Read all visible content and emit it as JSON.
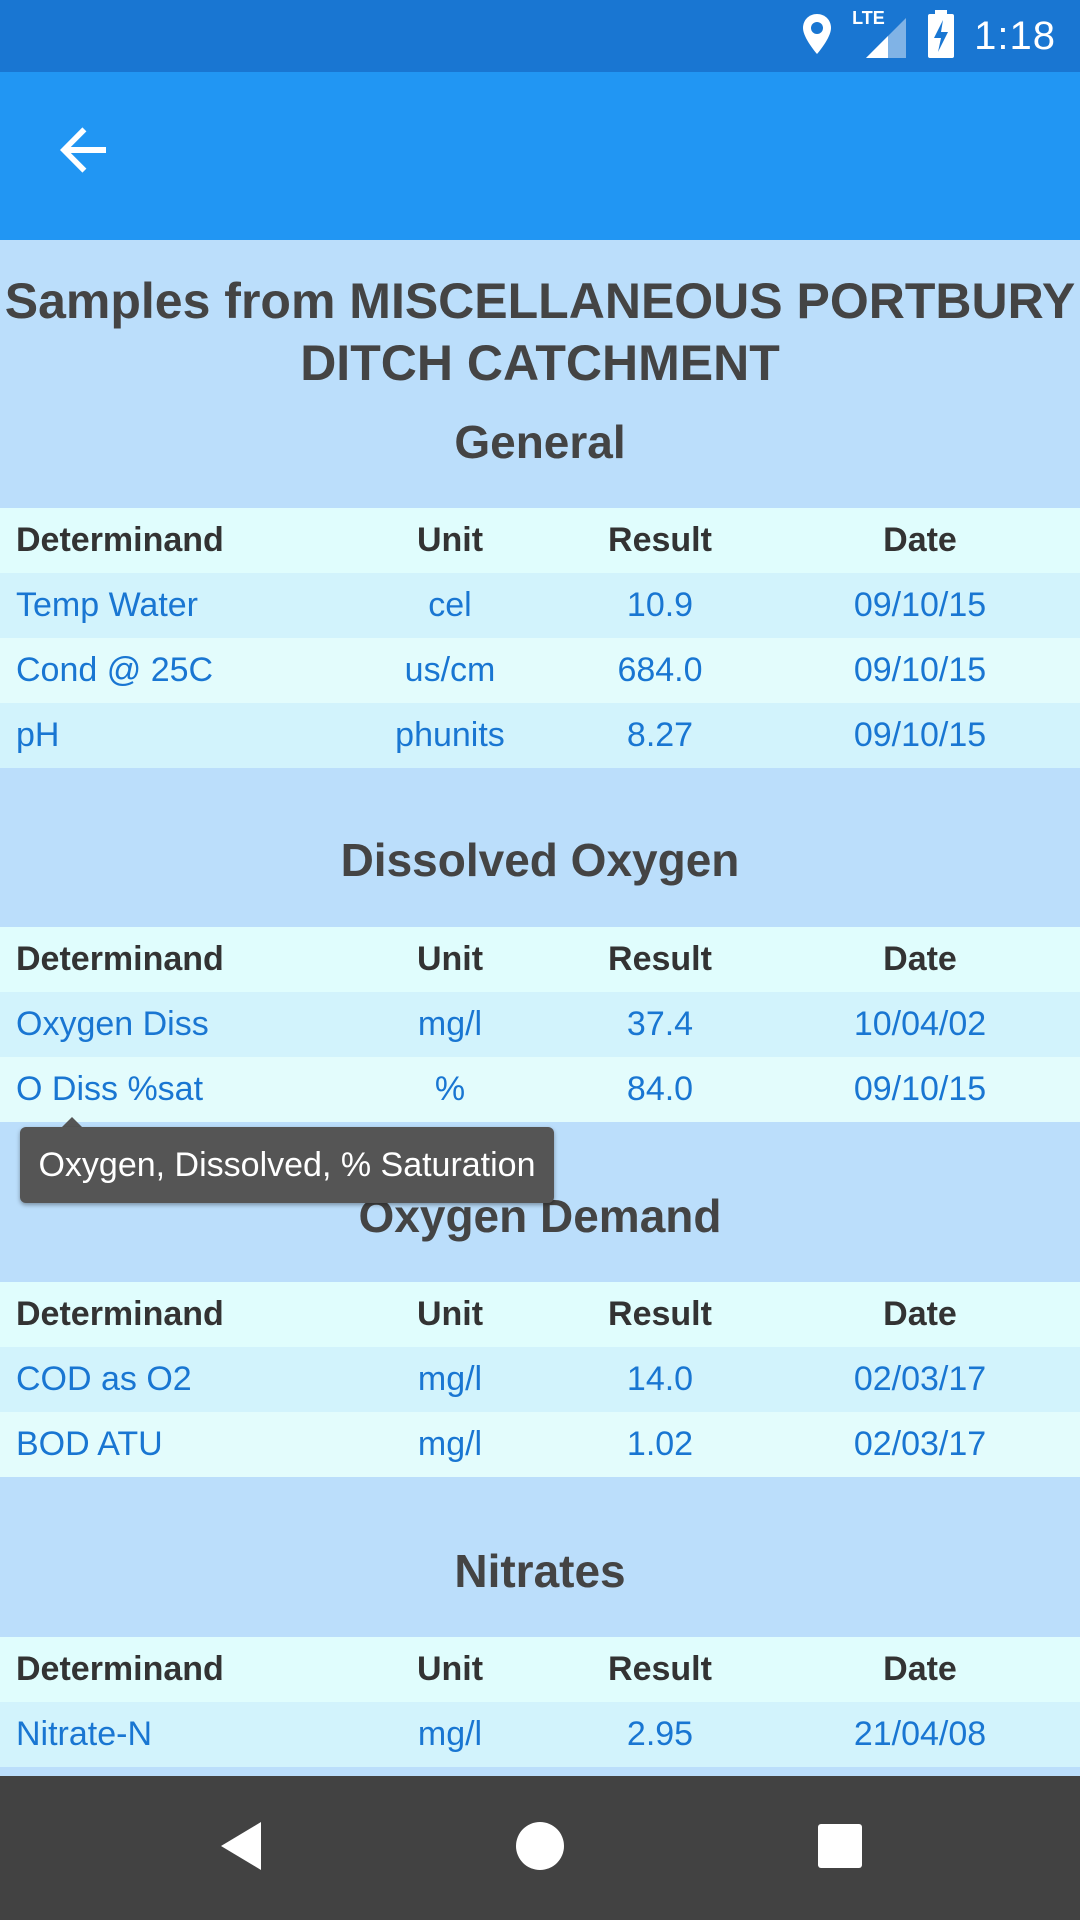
{
  "status_bar": {
    "time": "1:18",
    "network": "LTE",
    "icons": [
      "location-icon",
      "signal-icon",
      "battery-charging-icon"
    ]
  },
  "app_bar": {
    "back_icon": "arrow-back-icon"
  },
  "page_title": "Samples from MISCELLANEOUS PORTBURY DITCH CATCHMENT",
  "table_headers": {
    "determinand": "Determinand",
    "unit": "Unit",
    "result": "Result",
    "date": "Date"
  },
  "sections": [
    {
      "title": "General",
      "rows": [
        {
          "determinand": "Temp Water",
          "unit": "cel",
          "result": "10.9",
          "date": "09/10/15"
        },
        {
          "determinand": "Cond @ 25C",
          "unit": "us/cm",
          "result": "684.0",
          "date": "09/10/15"
        },
        {
          "determinand": "pH",
          "unit": "phunits",
          "result": "8.27",
          "date": "09/10/15"
        }
      ]
    },
    {
      "title": "Dissolved Oxygen",
      "rows": [
        {
          "determinand": "Oxygen Diss",
          "unit": "mg/l",
          "result": "37.4",
          "date": "10/04/02"
        },
        {
          "determinand": "O Diss %sat",
          "unit": "%",
          "result": "84.0",
          "date": "09/10/15"
        }
      ]
    },
    {
      "title": "Oxygen Demand",
      "rows": [
        {
          "determinand": "COD as O2",
          "unit": "mg/l",
          "result": "14.0",
          "date": "02/03/17"
        },
        {
          "determinand": "BOD ATU",
          "unit": "mg/l",
          "result": "1.02",
          "date": "02/03/17"
        }
      ]
    },
    {
      "title": "Nitrates",
      "rows": [
        {
          "determinand": "Nitrate-N",
          "unit": "mg/l",
          "result": "2.95",
          "date": "21/04/08"
        }
      ]
    }
  ],
  "tooltip": "Oxygen, Dissolved, % Saturation",
  "nav_bar": {
    "icons": [
      "nav-back-icon",
      "nav-home-icon",
      "nav-recents-icon"
    ]
  },
  "colors": {
    "status_bar": "#1976d2",
    "app_bar": "#2196f3",
    "page_bg": "#bbdefb",
    "link_text": "#1976d2",
    "nav_bar": "#424242"
  }
}
